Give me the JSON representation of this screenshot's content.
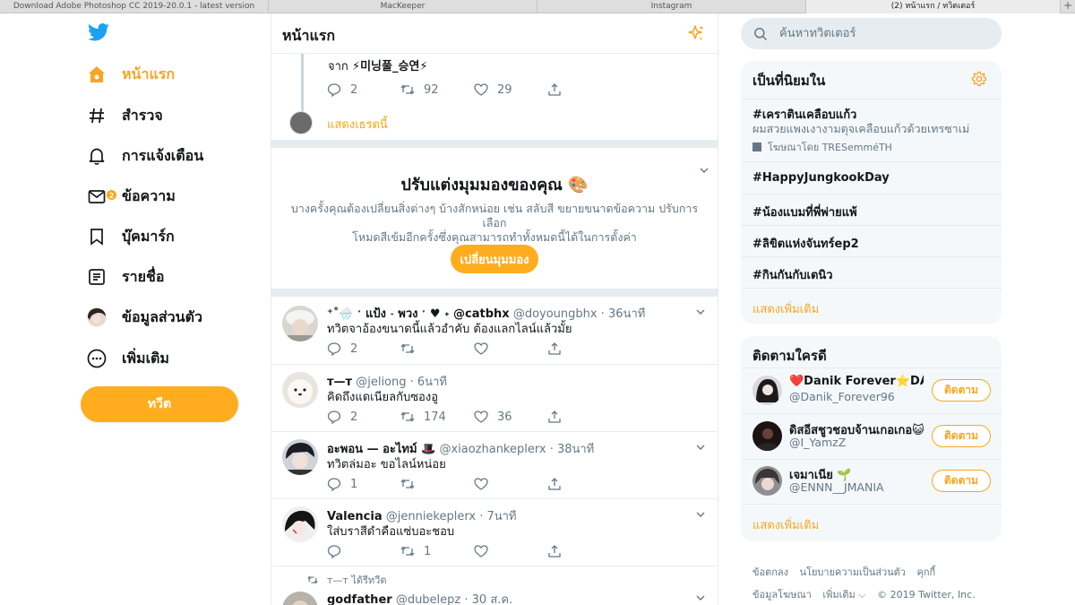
{
  "browser_tabs": [
    {
      "label": "Download Adobe Photoshop CC 2019-20.0.1 - latest version"
    },
    {
      "label": "MacKeeper"
    },
    {
      "label": "Instagram"
    },
    {
      "label": "(2) หน้าแรก / ทวิตเตอร์"
    }
  ],
  "nav": {
    "items": [
      {
        "label": "หน้าแรก"
      },
      {
        "label": "สำรวจ"
      },
      {
        "label": "การแจ้งเตือน"
      },
      {
        "label": "ข้อความ",
        "badge": "2"
      },
      {
        "label": "บุ๊คมาร์ก"
      },
      {
        "label": "รายชื่อ"
      },
      {
        "label": "ข้อมูลส่วนตัว"
      },
      {
        "label": "เพิ่มเติม"
      }
    ],
    "tweet_button": "ทวีต"
  },
  "timeline": {
    "title": "หน้าแรก",
    "thread": {
      "from_prefix": "จาก",
      "from_name": "⚡미닝풀_승연⚡",
      "replies": "2",
      "retweets": "92",
      "likes": "29",
      "show_thread": "แสดงเธรดนี้"
    },
    "customize": {
      "title": "ปรับแต่งมุมมองของคุณ 🎨",
      "desc_line1": "บางครั้งคุณต้องเปลี่ยนสิ่งต่างๆ บ้างสักหน่อย เช่น สลับสี ขยายขนาดข้อความ ปรับการเลือก",
      "desc_line2": "โหมดสีเข้มอีกครั้งซึ่งคุณสามารถทำทั้งหมดนี้ได้ในการตั้งค่า",
      "button": "เปลี่ยนมุมมอง"
    },
    "tweets": [
      {
        "name": "⁺˚🌧️ ˑ แป้ง ˗ พวง ˑ ♥︎ ˖ @catbhx",
        "handle": "@doyoungbhx",
        "time": "· 36นาที",
        "text": "ทวิตจาอ้องขนาดนี้แล้วอำคับ ต้องแลกไลน์แล้วมั้ย",
        "replies": "2",
        "retweets": "",
        "likes": ""
      },
      {
        "name": "ᴛ—ᴛ",
        "handle": "@jeliong",
        "time": "· 6นาที",
        "text": "คิดถึงแดเนียลกับซองอู",
        "replies": "2",
        "retweets": "174",
        "likes": "36"
      },
      {
        "name": "อะพอน — อะไทม์ 🎩",
        "handle": "@xiaozhankeplerx",
        "time": "· 38นาที",
        "text": "ทวิตล่มอะ ขอไลน์หน่อย",
        "replies": "1",
        "retweets": "",
        "likes": ""
      },
      {
        "name": "Valencia",
        "handle": "@jenniekeplerx",
        "time": "· 7นาที",
        "text": "ใส่บราสีดำคือแซ่บอะชอบ",
        "replies": "",
        "retweets": "1",
        "likes": ""
      },
      {
        "retweeted_by": "ᴛ—ᴛ ได้รีทวีต",
        "name": "godfather",
        "handle": "@dubelepz",
        "time": "· 30 ส.ค."
      }
    ]
  },
  "search": {
    "placeholder": "ค้นหาทวิตเตอร์"
  },
  "trends": {
    "title": "เป็นที่นิยมใน",
    "items": [
      {
        "tag": "#เคราตินเคลือบแก้ว",
        "desc": "ผมสวยแพงเงางามดุจเคลือบแก้วด้วยเทรซาเม่",
        "promoted": "โฆษณาโดย TRESemméTH"
      },
      {
        "tag": "#HappyJungkookDay"
      },
      {
        "tag": "#น้องแบมที่พี่พ่ายแพ้"
      },
      {
        "tag": "#ลิขิตแห่งจันทร์ep2"
      },
      {
        "tag": "#กินกันกับเตนิว"
      }
    ],
    "more": "แสดงเพิ่มเติม"
  },
  "who_to_follow": {
    "title": "ติดตามใครดี",
    "items": [
      {
        "name": "❤️Danik Forever⭐DA…",
        "handle": "@Danik_Forever96",
        "button": "ติดตาม"
      },
      {
        "name": "ดิสอีสชูวชอบจ้านเกอเกอ😺",
        "handle": "@I_YamzZ",
        "button": "ติดตาม"
      },
      {
        "name": "เจมาเนีย 🌱",
        "handle": "@ENNN__JMANIA",
        "button": "ติดตาม"
      }
    ],
    "more": "แสดงเพิ่มเติม"
  },
  "footer": {
    "terms": "ข้อตกลง",
    "privacy": "นโยบายความเป็นส่วนตัว",
    "cookies": "คุกกี้",
    "ads": "ข้อมูลโฆษณา",
    "more": "เพิ่มเติม ⌵",
    "copyright": "© 2019 Twitter, Inc."
  },
  "colors": {
    "accent": "#ffad1f",
    "border": "#e6ecf0",
    "muted": "#657786",
    "twitter_blue": "#1da1f2"
  }
}
